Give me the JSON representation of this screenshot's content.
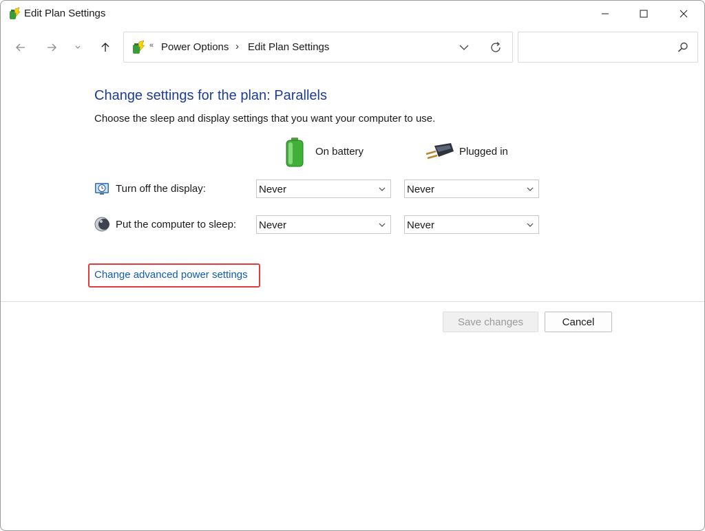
{
  "window": {
    "title": "Edit Plan Settings",
    "icon": "power-options-icon"
  },
  "nav": {
    "back_icon": "arrow-left-icon",
    "forward_icon": "arrow-right-icon",
    "recent_icon": "chevron-down-icon",
    "up_icon": "arrow-up-icon"
  },
  "address": {
    "crumbs": [
      "Power Options",
      "Edit Plan Settings"
    ],
    "separator_small": "«",
    "separator": "›"
  },
  "search": {
    "placeholder": "",
    "icon": "search-icon"
  },
  "main": {
    "title": "Change settings for the plan: Parallels",
    "description": "Choose the sleep and display settings that you want your computer to use.",
    "columns": {
      "on_battery": "On battery",
      "plugged_in": "Plugged in"
    },
    "rows": [
      {
        "label": "Turn off the display:",
        "icon": "display-clock-icon",
        "on_battery": "Never",
        "plugged_in": "Never"
      },
      {
        "label": "Put the computer to sleep:",
        "icon": "moon-icon",
        "on_battery": "Never",
        "plugged_in": "Never"
      }
    ],
    "advanced_link": "Change advanced power settings"
  },
  "footer": {
    "save_label": "Save changes",
    "cancel_label": "Cancel"
  },
  "colors": {
    "title_blue": "#1c3c94",
    "link_blue": "#0f5bb5",
    "highlight_red": "#e23b3b"
  }
}
